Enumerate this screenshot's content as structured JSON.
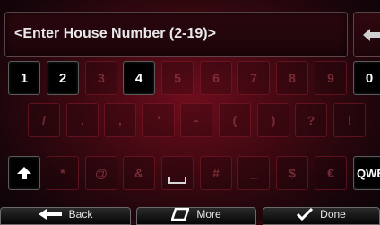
{
  "input": {
    "placeholder": "<Enter House Number (2-19)>"
  },
  "keys": {
    "row1": [
      "1",
      "2",
      "3",
      "4",
      "5",
      "6",
      "7",
      "8",
      "9",
      "0"
    ],
    "row2": [
      "/",
      ".",
      ",",
      "'",
      "-",
      "(",
      ")",
      "?",
      "!"
    ],
    "row3": [
      "*",
      "@",
      "&",
      "#",
      "_",
      "$",
      "€"
    ],
    "qwerty_label": "QWE"
  },
  "enabled_keys": [
    "1",
    "2",
    "4",
    "0"
  ],
  "buttons": {
    "back": "Back",
    "more": "More",
    "done": "Done"
  },
  "icons": {
    "backspace": "backspace-arrow-icon",
    "shift": "shift-arrow-icon",
    "back": "left-arrow-icon",
    "more": "more-icon",
    "done": "checkmark-icon"
  }
}
